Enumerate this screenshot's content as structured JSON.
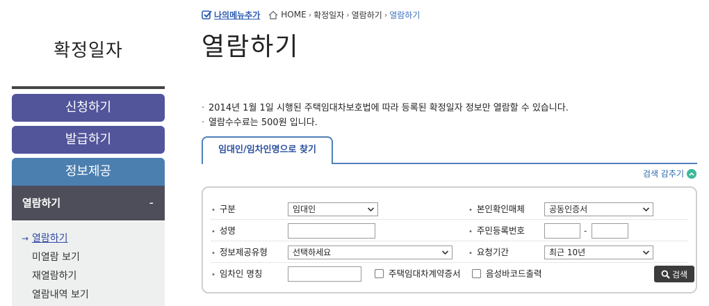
{
  "sidebar": {
    "title": "확정일자",
    "menu": [
      "신청하기",
      "발급하기",
      "정보제공"
    ],
    "submenu_title": "열람하기",
    "submenu_toggle": "-",
    "items": [
      "열람하기",
      "미열람 보기",
      "재열람하기",
      "열람내역 보기"
    ],
    "active_arrow": "→"
  },
  "breadcrumb": {
    "mymenu": "나의메뉴추가",
    "home": "HOME",
    "separator": "›",
    "path": [
      "확정일자",
      "열람하기",
      "열람하기"
    ]
  },
  "page": {
    "title": "열람하기"
  },
  "notices": {
    "bullet": "·",
    "lines": [
      "2014년 1월 1일 시행된 주택임대차보호법에 따라 등록된 확정일자 정보만 열람할 수 있습니다.",
      "열람수수료는 500원 입니다."
    ]
  },
  "tab": {
    "label": "임대인/임차인명으로 찾기"
  },
  "collapse": {
    "label": "검색 감추기"
  },
  "form": {
    "bullet": "•",
    "fields": {
      "division": {
        "label": "구분",
        "value": "임대인"
      },
      "id_medium": {
        "label": "본인확인매체",
        "value": "공동인증서"
      },
      "name": {
        "label": "성명",
        "value": ""
      },
      "rrn": {
        "label": "주민등록번호",
        "dash": "-",
        "value1": "",
        "value2": ""
      },
      "info_type": {
        "label": "정보제공유형",
        "value": "선택하세요"
      },
      "period": {
        "label": "요청기간",
        "value": "최근 10년"
      },
      "tenant_name": {
        "label": "임차인 명칭",
        "value": ""
      }
    },
    "checkboxes": [
      {
        "label": "주택임대차계약증서",
        "checked": false
      },
      {
        "label": "음성바코드출력",
        "checked": false
      }
    ],
    "search_button": "검색"
  }
}
